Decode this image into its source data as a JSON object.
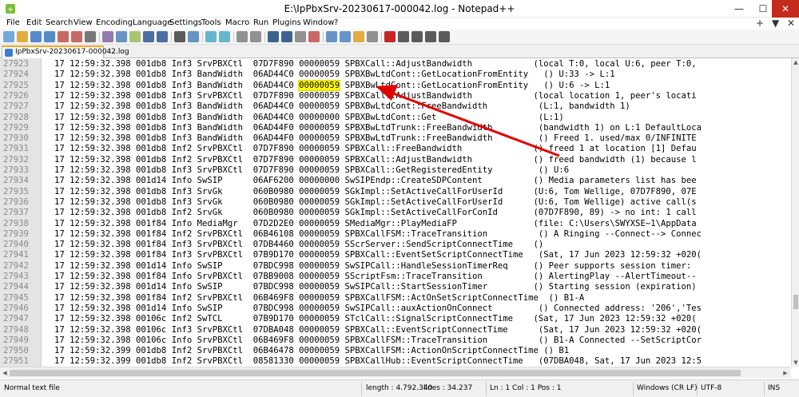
{
  "window": {
    "title": "E:\\IpPbxSrv-20230617-000042.log - Notepad++",
    "minimize": "—",
    "maximize": "☐",
    "close": "✕"
  },
  "menu": {
    "items": [
      "File",
      "Edit",
      "Search",
      "View",
      "Encoding",
      "Language",
      "Settings",
      "Tools",
      "Macro",
      "Run",
      "Plugins",
      "Window",
      "?"
    ],
    "right": [
      "+",
      "▼",
      "✕"
    ]
  },
  "toolbar": {
    "icons": [
      "new-file-icon",
      "open-file-icon",
      "save-icon",
      "save-all-icon",
      "close-icon",
      "close-all-icon",
      "print-icon",
      "cut-icon",
      "copy-icon",
      "paste-icon",
      "undo-icon",
      "redo-icon",
      "find-icon",
      "replace-icon",
      "zoom-in-icon",
      "zoom-out-icon",
      "sync-v-icon",
      "sync-h-icon",
      "word-wrap-icon",
      "show-all-chars-icon",
      "indent-guide-icon",
      "udl-icon",
      "doc-map-icon",
      "function-list-icon",
      "folder-workspace-icon",
      "monitor-icon",
      "record-macro-icon",
      "stop-macro-icon",
      "play-macro-icon",
      "run-macro-multiple-icon",
      "save-macro-icon"
    ]
  },
  "tab": {
    "label": "IpPbxSrv-20230617-000042.log"
  },
  "editor": {
    "lines": [
      {
        "no": "27923",
        "text": "17 12:59:32.398 001db8 Inf3 SrvPBXCtl  07D7F890 00000059 SPBXCall::AdjustBandwidth            (local T:0, local U:6, peer T:0,"
      },
      {
        "no": "27924",
        "text": "17 12:59:32.398 001db8 Inf3 BandWidth  06AD44C0 00000059 SPBXBwLtdCont::GetLocationFromEntity   () U:33 -> L:1"
      },
      {
        "no": "27925",
        "pre": "17 12:59:32.398 001db8 Inf3 BandWidth  06AD44C0 ",
        "hl": "00000059",
        "post": " SPBXBwLtdCont::GetLocationFromEntity   () U:6 -> L:1"
      },
      {
        "no": "27926",
        "text": "17 12:59:32.398 001db8 Inf3 SrvPBXCtl  07D7F890 00000059 SPBXCall::AdjustBandwidth            (local location 1, peer's locati"
      },
      {
        "no": "27927",
        "text": "17 12:59:32.398 001db8 Inf3 BandWidth  06AD44C0 00000059 SPBXBwLtdCont::FreeBandwidth          (L:1, bandwidth 1)"
      },
      {
        "no": "27928",
        "text": "17 12:59:32.398 001db8 Inf3 BandWidth  06AD44C0 00000000 SPBXBwLtdCont::Get                    (L:1)"
      },
      {
        "no": "27929",
        "text": "17 12:59:32.398 001db8 Inf3 BandWidth  06AD44F0 00000059 SPBXBwLtdTrunk::FreeBandwidth         (bandwidth 1) on L:1 DefaultLoca"
      },
      {
        "no": "27930",
        "text": "17 12:59:32.398 001db8 Inf3 BandWidth  06AD44F0 00000059 SPBXBwLtdTrunk::FreeBandwidth         () Freed 1. used/max 0/INFINITE"
      },
      {
        "no": "27931",
        "text": "17 12:59:32.398 001db8 Inf2 SrvPBXCtl  07D7F890 00000059 SPBXCall::FreeBandwidth              () freed 1 at location [1] Defau"
      },
      {
        "no": "27932",
        "text": "17 12:59:32.398 001db8 Inf2 SrvPBXCtl  07D7F890 00000059 SPBXCall::AdjustBandwidth            () freed bandwidth (1) because l"
      },
      {
        "no": "27933",
        "text": "17 12:59:32.398 001db8 Inf3 SrvPBXCtl  07D7F890 00000059 SPBXCall::GetRegisteredEntity         () U:6"
      },
      {
        "no": "27934",
        "text": "17 12:59:32.398 001d14 Info SwSIP      06AF6200 00000000 SwSIPEndp::CreateSDPContent          () Media parameters list has bee"
      },
      {
        "no": "27935",
        "text": "17 12:59:32.398 001db8 Inf3 SrvGk      060B0980 00000059 SGkImpl::SetActiveCallForUserId      (U:6, Tom Wellige, 07D7F890, 07E"
      },
      {
        "no": "27936",
        "text": "17 12:59:32.398 001db8 Inf3 SrvGk      060B0980 00000059 SGkImpl::SetActiveCallForUserId      (U:6, Tom Wellige) active call(s"
      },
      {
        "no": "27937",
        "text": "17 12:59:32.398 001db8 Inf2 SrvGk      060B0980 00000059 SGkImpl::SetActiveCallForConId       (07D7F890, 89) -> no int: 1 call"
      },
      {
        "no": "27938",
        "text": "17 12:59:32.398 001f84 Info MediaMgr   07D2D2E0 00000059 SMediaMgr::PlayMediaFP               (file: C:\\Users\\SWYXSE~1\\AppData"
      },
      {
        "no": "27939",
        "text": "17 12:59:32.398 001f84 Inf2 SrvPBXCtl  06B46108 00000059 SPBXCallFSM::TraceTransition          () A Ringing --Connect--> Connec"
      },
      {
        "no": "27940",
        "text": "17 12:59:32.398 001f84 Inf3 SrvPBXCtl  07DB4460 00000059 SScrServer::SendScriptConnectTime    ()"
      },
      {
        "no": "27941",
        "text": "17 12:59:32.398 001f84 Inf3 SrvPBXCtl  07B9D170 00000059 SPBXCall::EventSetScriptConnectTime   (Sat, 17 Jun 2023 12:59:32 +020("
      },
      {
        "no": "27942",
        "text": "17 12:59:32.398 001d14 Info SwSIP      07BDC998 00000059 SwSIPCall::HandleSessionTimerReq     () Peer supports session timer:"
      },
      {
        "no": "27943",
        "text": "17 12:59:32.398 001f84 Info SrvPBXCtl  07BB9008 00000059 SScriptFsm::TraceTransition          () AlertingPlay --AlertTimeout--"
      },
      {
        "no": "27944",
        "text": "17 12:59:32.398 001d14 Info SwSIP      07BDC998 00000059 SwSIPCall::StartSessionTimer         () Starting session (expiration)"
      },
      {
        "no": "27945",
        "text": "17 12:59:32.398 001f84 Inf2 SrvPBXCtl  06B469F8 00000059 SPBXCallFSM::ActOnSetScriptConnectTime  () B1-A"
      },
      {
        "no": "27946",
        "text": "17 12:59:32.398 001d14 Info SwSIP      07BDC998 00000059 SwSIPCall::auxActionOnConnect         () Connected address: '206','Tes"
      },
      {
        "no": "27947",
        "text": "17 12:59:32.398 00106c Inf2 SwTCL      07B9D170 00000059 STclCall::SignalScriptConnectTime    (Sat, 17 Jun 2023 12:59:32 +020("
      },
      {
        "no": "27948",
        "text": "17 12:59:32.398 00106c Inf3 SrvPBXCtl  07DBA048 00000059 SPBXCall::EventScriptConnectTime      (Sat, 17 Jun 2023 12:59:32 +020("
      },
      {
        "no": "27949",
        "text": "17 12:59:32.398 00106c Info SrvPBXCtl  06B469F8 00000059 SPBXCallFSM::TraceTransition          () B1-A Connected --SetScriptCor"
      },
      {
        "no": "27950",
        "text": "17 12:59:32.399 001db8 Inf2 SrvPBXCtl  06B46478 00000059 SPBXCallFSM::ActionOnScriptConnectTime () B1"
      },
      {
        "no": "27951",
        "text": "17 12:59:32.399 001db8 Inf2 SrvPBXCtl  08581330 00000059 SPBXCallHub::EventScriptConnectTime   (07DBA048, Sat, 17 Jun 2023 12:5"
      }
    ]
  },
  "statusbar": {
    "filetype": "Normal text file",
    "length": "length : 4.792.340",
    "lines": "lines : 34.237",
    "position": "Ln : 1    Col : 1    Pos : 1",
    "eol": "Windows (CR LF)",
    "encoding": "UTF-8",
    "mode": "INS"
  },
  "colors": {
    "highlight": "#ffff00",
    "annotation_arrow": "#e00000",
    "tab_accent": "#f7a51f"
  }
}
